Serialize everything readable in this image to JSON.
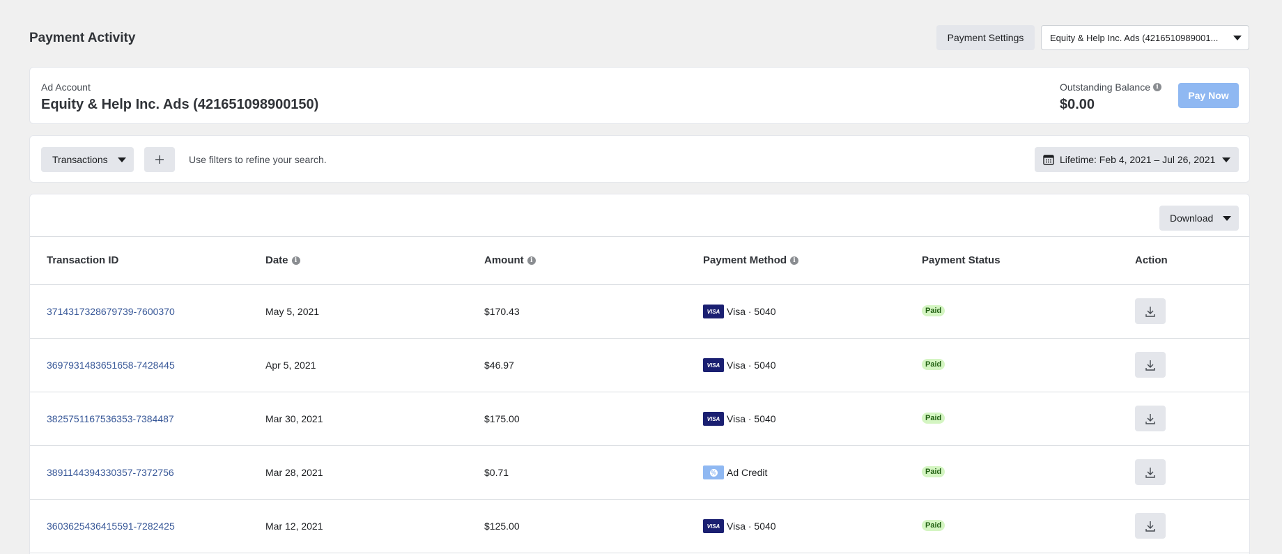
{
  "header": {
    "title": "Payment Activity",
    "settings_label": "Payment Settings",
    "account_selector": "Equity & Help Inc. Ads (4216510989001..."
  },
  "account_card": {
    "label": "Ad Account",
    "name": "Equity & Help Inc. Ads (421651098900150)",
    "balance_label": "Outstanding Balance",
    "balance_value": "$0.00",
    "pay_now_label": "Pay Now"
  },
  "filters": {
    "transactions_label": "Transactions",
    "add_icon": "plus-icon",
    "hint": "Use filters to refine your search.",
    "date_range": "Lifetime: Feb 4, 2021 – Jul 26, 2021"
  },
  "table": {
    "download_label": "Download",
    "columns": [
      "Transaction ID",
      "Date",
      "Amount",
      "Payment Method",
      "Payment Status",
      "Action"
    ],
    "rows": [
      {
        "id": "3714317328679739-7600370",
        "date": "May 5, 2021",
        "amount": "$170.43",
        "method_icon": "visa-icon",
        "method_badge": "VISA",
        "method": "Visa · 5040",
        "status": "Paid"
      },
      {
        "id": "3697931483651658-7428445",
        "date": "Apr 5, 2021",
        "amount": "$46.97",
        "method_icon": "visa-icon",
        "method_badge": "VISA",
        "method": "Visa · 5040",
        "status": "Paid"
      },
      {
        "id": "3825751167536353-7384487",
        "date": "Mar 30, 2021",
        "amount": "$175.00",
        "method_icon": "visa-icon",
        "method_badge": "VISA",
        "method": "Visa · 5040",
        "status": "Paid"
      },
      {
        "id": "3891144394330357-7372756",
        "date": "Mar 28, 2021",
        "amount": "$0.71",
        "method_icon": "ad-credit-icon",
        "method_badge": "",
        "method": "Ad Credit",
        "status": "Paid"
      },
      {
        "id": "3603625436415591-7282425",
        "date": "Mar 12, 2021",
        "amount": "$125.00",
        "method_icon": "visa-icon",
        "method_badge": "VISA",
        "method": "Visa · 5040",
        "status": "Paid"
      }
    ]
  },
  "colors": {
    "link": "#385898",
    "pay_now": "#8fb8f2",
    "paid_badge": "#d4f5c2",
    "visa": "#1a1f71"
  }
}
